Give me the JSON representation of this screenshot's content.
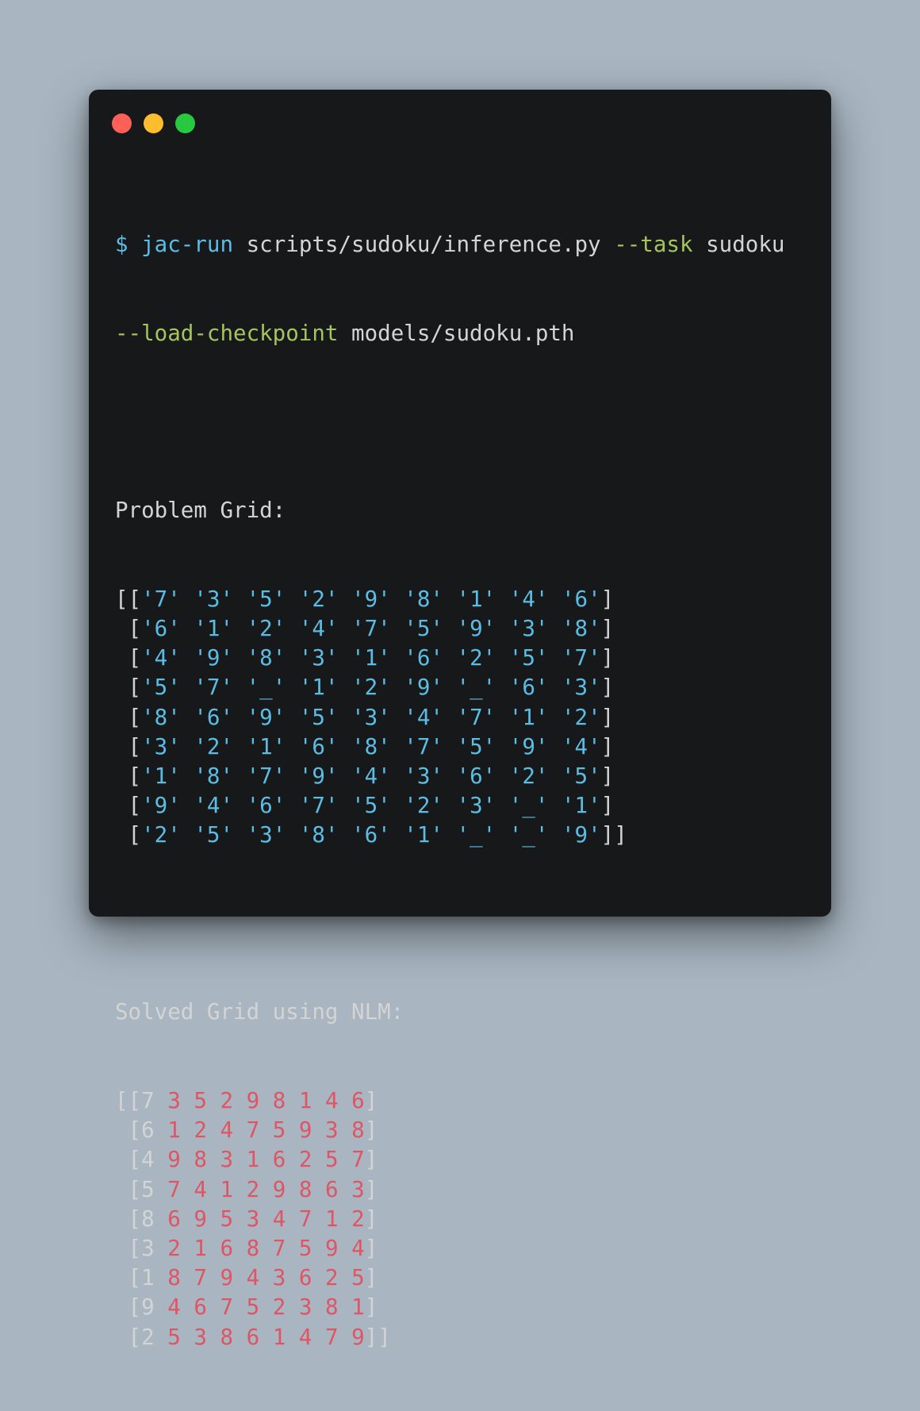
{
  "command": {
    "prompt": "$",
    "executable": "jac-run",
    "script": "scripts/sudoku/inference.py",
    "task_flag": "--task",
    "task_value": "sudoku",
    "checkpoint_flag": "--load-checkpoint",
    "checkpoint_value": "models/sudoku.pth"
  },
  "problem": {
    "heading": "Problem Grid:",
    "rows": [
      [
        "7",
        "3",
        "5",
        "2",
        "9",
        "8",
        "1",
        "4",
        "6"
      ],
      [
        "6",
        "1",
        "2",
        "4",
        "7",
        "5",
        "9",
        "3",
        "8"
      ],
      [
        "4",
        "9",
        "8",
        "3",
        "1",
        "6",
        "2",
        "5",
        "7"
      ],
      [
        "5",
        "7",
        "_",
        "1",
        "2",
        "9",
        "_",
        "6",
        "3"
      ],
      [
        "8",
        "6",
        "9",
        "5",
        "3",
        "4",
        "7",
        "1",
        "2"
      ],
      [
        "3",
        "2",
        "1",
        "6",
        "8",
        "7",
        "5",
        "9",
        "4"
      ],
      [
        "1",
        "8",
        "7",
        "9",
        "4",
        "3",
        "6",
        "2",
        "5"
      ],
      [
        "9",
        "4",
        "6",
        "7",
        "5",
        "2",
        "3",
        "_",
        "1"
      ],
      [
        "2",
        "5",
        "3",
        "8",
        "6",
        "1",
        "_",
        "_",
        "9"
      ]
    ]
  },
  "solved": {
    "heading": "Solved Grid using NLM:",
    "rows": [
      [
        "7",
        "3",
        "5",
        "2",
        "9",
        "8",
        "1",
        "4",
        "6"
      ],
      [
        "6",
        "1",
        "2",
        "4",
        "7",
        "5",
        "9",
        "3",
        "8"
      ],
      [
        "4",
        "9",
        "8",
        "3",
        "1",
        "6",
        "2",
        "5",
        "7"
      ],
      [
        "5",
        "7",
        "4",
        "1",
        "2",
        "9",
        "8",
        "6",
        "3"
      ],
      [
        "8",
        "6",
        "9",
        "5",
        "3",
        "4",
        "7",
        "1",
        "2"
      ],
      [
        "3",
        "2",
        "1",
        "6",
        "8",
        "7",
        "5",
        "9",
        "4"
      ],
      [
        "1",
        "8",
        "7",
        "9",
        "4",
        "3",
        "6",
        "2",
        "5"
      ],
      [
        "9",
        "4",
        "6",
        "7",
        "5",
        "2",
        "3",
        "8",
        "1"
      ],
      [
        "2",
        "5",
        "3",
        "8",
        "6",
        "1",
        "4",
        "7",
        "9"
      ]
    ]
  },
  "colors": {
    "window_bg": "#17181a",
    "page_bg": "#a9b6c1",
    "text": "#d4d4d4",
    "cyan": "#5bbde4",
    "green": "#a5c45e",
    "red": "#df5564"
  }
}
